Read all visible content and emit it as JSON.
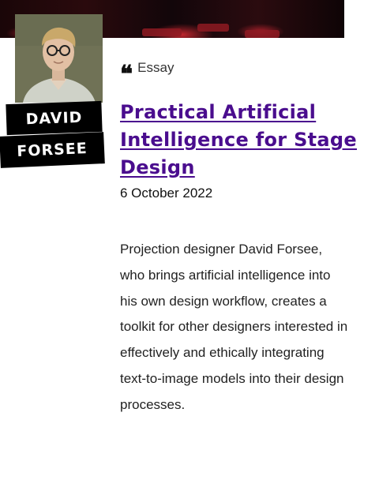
{
  "author": {
    "first_name": "DAVID",
    "last_name": "FORSEE"
  },
  "article": {
    "category": "Essay",
    "title": "Practical Artificial Intelligence for Stage Design",
    "date": "6 October 2022",
    "summary": "Projection designer David Forsee, who brings artificial intelligence into his own design workflow, creates a toolkit for other designers interested in effectively and ethically integrating text-to-image models into their design processes."
  },
  "icons": {
    "category": "quote-icon"
  },
  "colors": {
    "title": "#4a0d8e",
    "name_tag_bg": "#000000",
    "name_tag_text": "#ffffff"
  }
}
